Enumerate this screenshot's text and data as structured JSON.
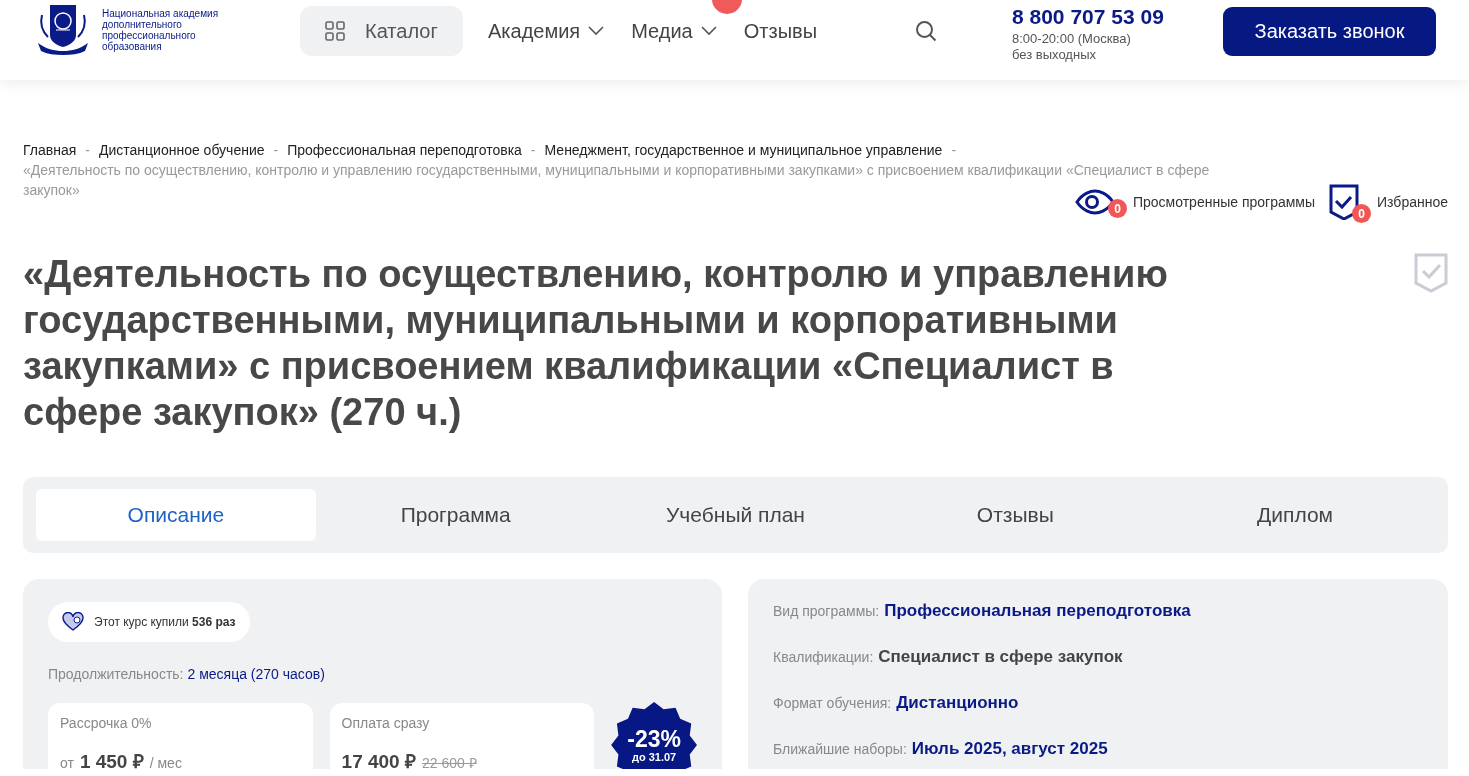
{
  "header": {
    "logo_text": "Национальная академия дополнительного профессионального образования",
    "catalog": {
      "label": "Каталог"
    },
    "nav": [
      {
        "label": "Академия",
        "dropdown": true
      },
      {
        "label": "Медиа",
        "dropdown": true
      },
      {
        "label": "Отзывы",
        "dropdown": false
      }
    ],
    "phone": "8 800 707 53 09",
    "hours": [
      "8:00-20:00 (Москва)",
      "без выходных"
    ],
    "cta": "Заказать звонок"
  },
  "breadcrumbs": {
    "separator": "-",
    "items": [
      "Главная",
      "Дистанционное обучение",
      "Профессиональная переподготовка",
      "Менеджмент, государственное и муниципальное управление"
    ],
    "current": "«Деятельность по осуществлению, контролю и управлению государственными, муниципальными и корпоративными закупками» с присвоением квалификации «Специалист в сфере закупок»"
  },
  "counters": [
    {
      "kind": "eye",
      "count": "0",
      "label": "Просмотренные программы"
    },
    {
      "kind": "shield",
      "count": "0",
      "label": "Избранное"
    }
  ],
  "title": "«Деятельность по осуществлению, контролю и управлению государственными, муниципальными и корпоративными закупками» с присвоением квалификации «Специалист в сфере закупок» (270 ч.)",
  "tabs": [
    {
      "label": "Описание",
      "selected": true
    },
    {
      "label": "Программа",
      "selected": false
    },
    {
      "label": "Учебный план",
      "selected": false
    },
    {
      "label": "Отзывы",
      "selected": false
    },
    {
      "label": "Диплом",
      "selected": false
    }
  ],
  "purchases": "Этот курс купили **536 раз**",
  "duration": {
    "label": "Продолжительность:",
    "value": "2 месяца (270 часов)"
  },
  "prices": [
    {
      "label": "Рассрочка 0%",
      "prefix": "от",
      "amount": "1 450 ₽",
      "suffix": "/ мес"
    },
    {
      "label": "Оплата сразу",
      "amount": "17 400 ₽",
      "old_amount": "22 600 ₽"
    }
  ],
  "discount": {
    "percent": "-23%",
    "until": "до 31.07"
  },
  "details": [
    {
      "label": "Вид программы:",
      "value": "Профессиональная переподготовка",
      "accent": true
    },
    {
      "label": "Квалификации:",
      "value": "Специалист в сфере закупок",
      "accent": false
    },
    {
      "label": "Формат обучения:",
      "value": "Дистанционно",
      "accent": true
    },
    {
      "label": "Ближайшие наборы:",
      "value": "Июль 2025, август 2025",
      "accent": true
    }
  ]
}
